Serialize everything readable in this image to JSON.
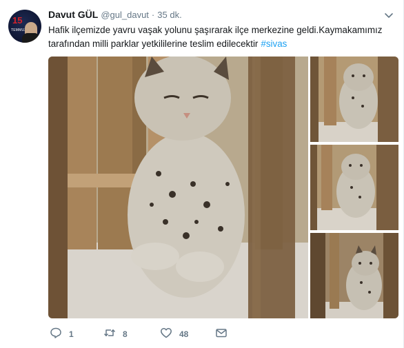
{
  "tweet": {
    "author_name": "Davut GÜL",
    "author_handle": "@gul_davut",
    "separator": "·",
    "time": "35 dk.",
    "text_line1": "Hafik ilçemizde yavru vaşak yolunu şaşırarak ilçe merkezine geldi.Kaymakamımız",
    "text_line2": "tarafından milli parklar yetkililerine teslim edilecektir",
    "hashtag": "#sivas",
    "avatar_text": "15",
    "avatar_subtext": "TEMMUZ",
    "reply_count": "1",
    "retweet_count": "8",
    "like_count": "48"
  },
  "icons": {
    "caret": "chevron-down-icon",
    "reply": "speech-bubble-icon",
    "retweet": "retweet-icon",
    "like": "heart-icon",
    "dm": "envelope-icon"
  },
  "colors": {
    "text": "#14171a",
    "secondary": "#657786",
    "hashtag": "#1da1f2",
    "wood": "#8b6f4e",
    "fur": "#c9c3b6"
  }
}
